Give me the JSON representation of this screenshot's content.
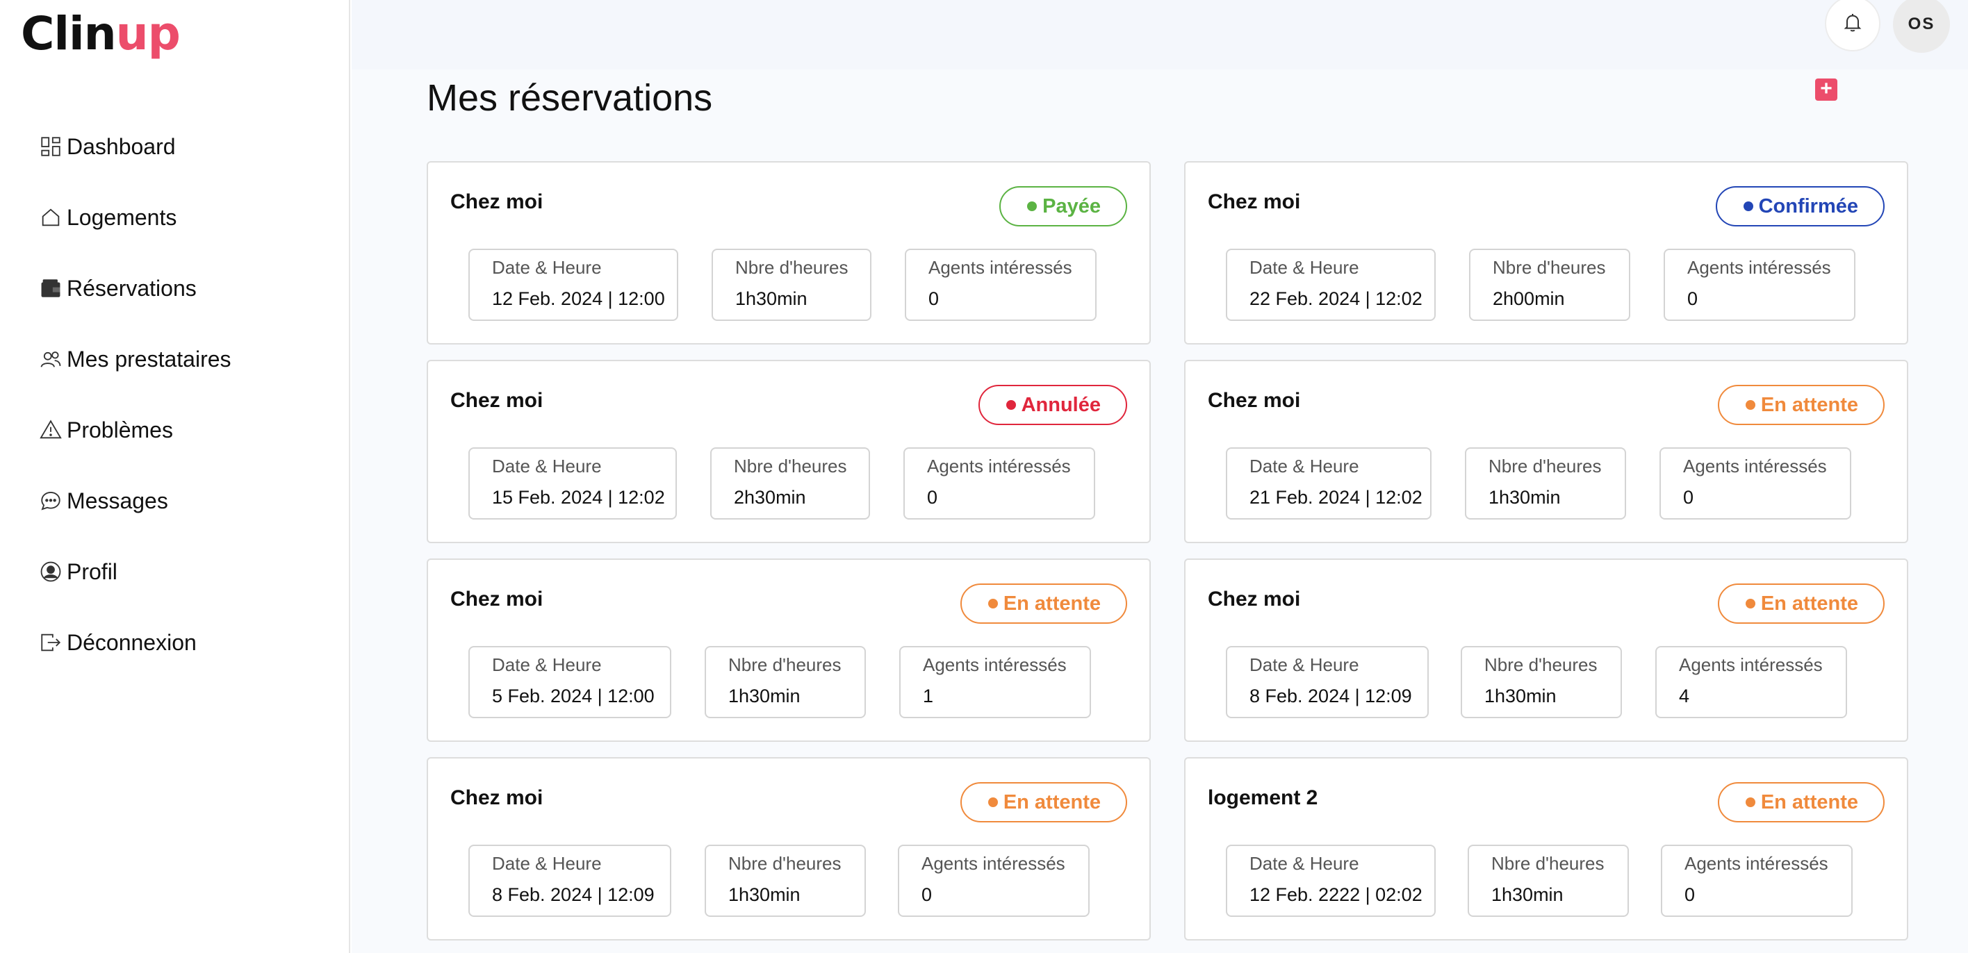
{
  "brand": {
    "part1": "Clin",
    "part2": "up",
    "color_dark": "#111111",
    "color_accent": "#ec4d6b"
  },
  "sidebar": {
    "items": [
      {
        "label": "Dashboard",
        "icon": "dashboard-icon"
      },
      {
        "label": "Logements",
        "icon": "home-icon"
      },
      {
        "label": "Réservations",
        "icon": "wallet-icon"
      },
      {
        "label": "Mes prestataires",
        "icon": "users-icon"
      },
      {
        "label": "Problèmes",
        "icon": "warning-icon"
      },
      {
        "label": "Messages",
        "icon": "chat-icon"
      },
      {
        "label": "Profil",
        "icon": "user-circle-icon"
      },
      {
        "label": "Déconnexion",
        "icon": "logout-icon"
      }
    ]
  },
  "header": {
    "avatar_initials": "OS",
    "bell_icon": "bell-icon"
  },
  "page": {
    "title": "Mes réservations",
    "add_label": "+"
  },
  "labels": {
    "date": "Date & Heure",
    "hours": "Nbre d'heures",
    "agents": "Agents intéressés"
  },
  "status_colors": {
    "Payée": "#5bb343",
    "Confirmée": "#2346b6",
    "Annulée": "#e0263c",
    "En attente": "#f08a3c"
  },
  "reservations": [
    {
      "name": "Chez moi",
      "status": "Payée",
      "date": "12 Feb. 2024 | 12:00",
      "hours": "1h30min",
      "agents": "0"
    },
    {
      "name": "Chez moi",
      "status": "Confirmée",
      "date": "22 Feb. 2024 | 12:02",
      "hours": "2h00min",
      "agents": "0"
    },
    {
      "name": "Chez moi",
      "status": "Annulée",
      "date": "15 Feb. 2024 | 12:02",
      "hours": "2h30min",
      "agents": "0"
    },
    {
      "name": "Chez moi",
      "status": "En attente",
      "date": "21 Feb. 2024 | 12:02",
      "hours": "1h30min",
      "agents": "0"
    },
    {
      "name": "Chez moi",
      "status": "En attente",
      "date": "5 Feb. 2024 | 12:00",
      "hours": "1h30min",
      "agents": "1"
    },
    {
      "name": "Chez moi",
      "status": "En attente",
      "date": "8 Feb. 2024 | 12:09",
      "hours": "1h30min",
      "agents": "4"
    },
    {
      "name": "Chez moi",
      "status": "En attente",
      "date": "8 Feb. 2024 | 12:09",
      "hours": "1h30min",
      "agents": "0"
    },
    {
      "name": "logement 2",
      "status": "En attente",
      "date": "12 Feb. 2222 | 02:02",
      "hours": "1h30min",
      "agents": "0"
    }
  ]
}
